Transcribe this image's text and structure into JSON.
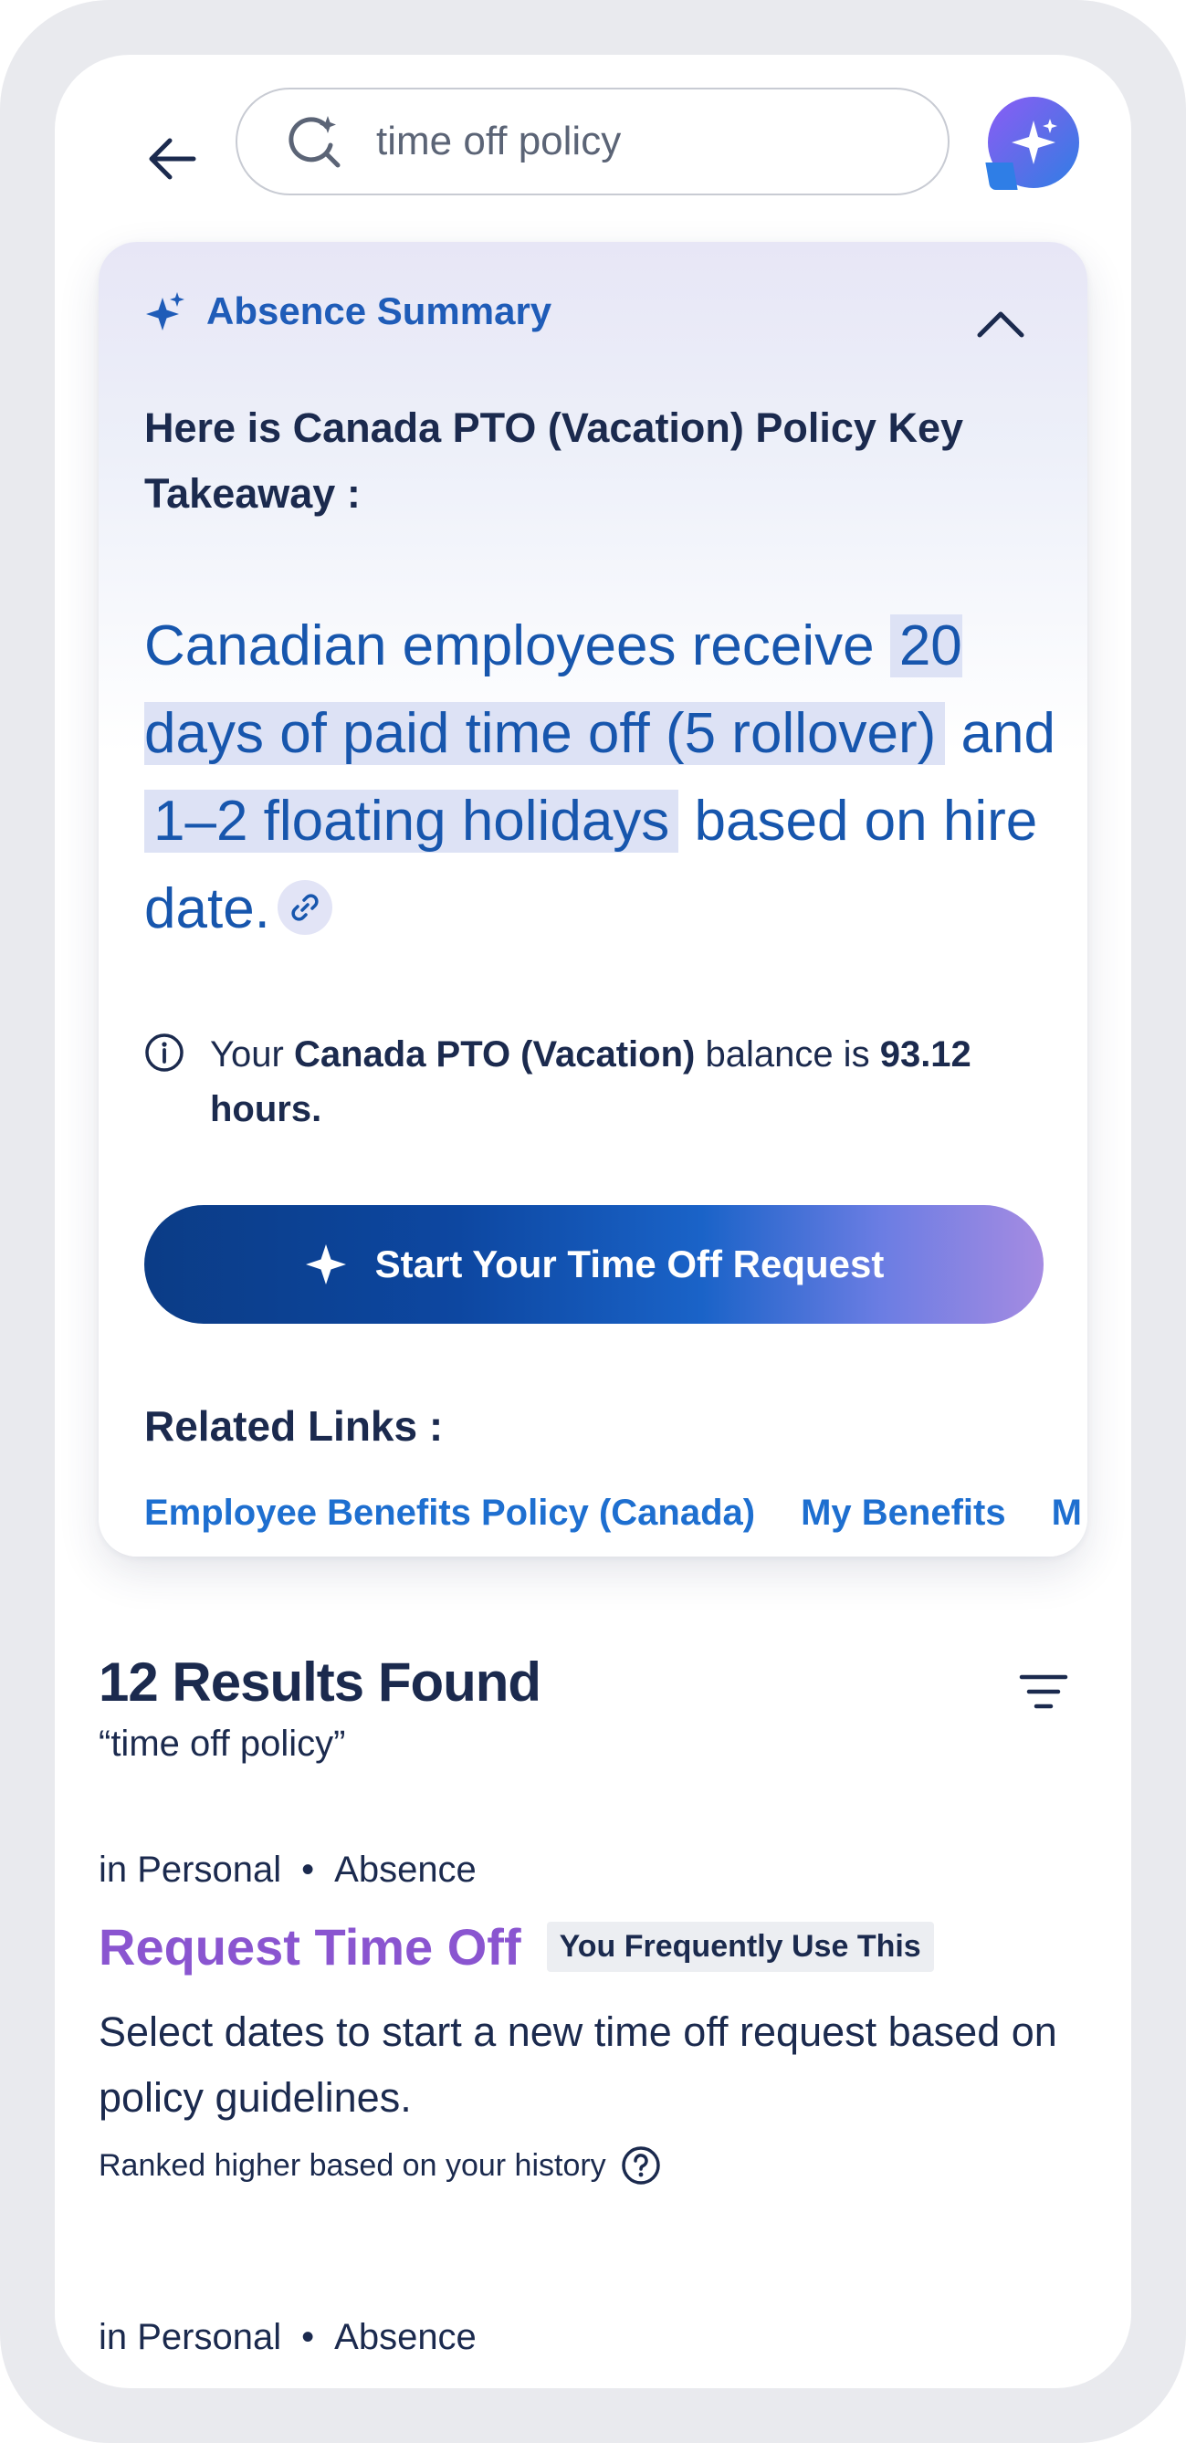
{
  "search": {
    "query": "time off policy"
  },
  "summary": {
    "title": "Absence Summary",
    "subtitle": "Here is Canada PTO (Vacation) Policy Key Takeaway :",
    "takeaway": {
      "part1": "Canadian employees receive",
      "hl1": "20 days of paid time off (5 rollover)",
      "part2": "and",
      "hl2": "1–2 floating holidays",
      "part3": "based on hire date."
    },
    "balance": {
      "prefix": "Your",
      "plan": "Canada PTO (Vacation)",
      "middle": "balance is",
      "amount": "93.12 hours."
    },
    "start_button": "Start Your Time Off Request",
    "related_title": "Related Links :",
    "related_links": [
      "Employee Benefits Policy (Canada)",
      "My Benefits",
      "M"
    ]
  },
  "results": {
    "count_label": "12 Results Found",
    "query_label": "“time off policy”",
    "items": [
      {
        "scope": "in Personal",
        "category": "Absence",
        "title": "Request Time Off",
        "badge": "You Frequently Use This",
        "description": "Select dates to start a new time off request based on policy guidelines.",
        "rank_note": "Ranked higher based on your history"
      },
      {
        "scope": "in Personal",
        "category": "Absence"
      }
    ]
  },
  "colors": {
    "accent_blue": "#1756ad",
    "link_blue": "#1e6fd0",
    "result_title_purple": "#8a55d0",
    "text_dark": "#1b2a4e"
  },
  "icons": [
    "back-arrow-icon",
    "ai-search-icon",
    "assistant-chat-icon",
    "sparkle-icon",
    "chevron-up-icon",
    "link-icon",
    "info-icon",
    "filter-icon",
    "help-icon"
  ]
}
